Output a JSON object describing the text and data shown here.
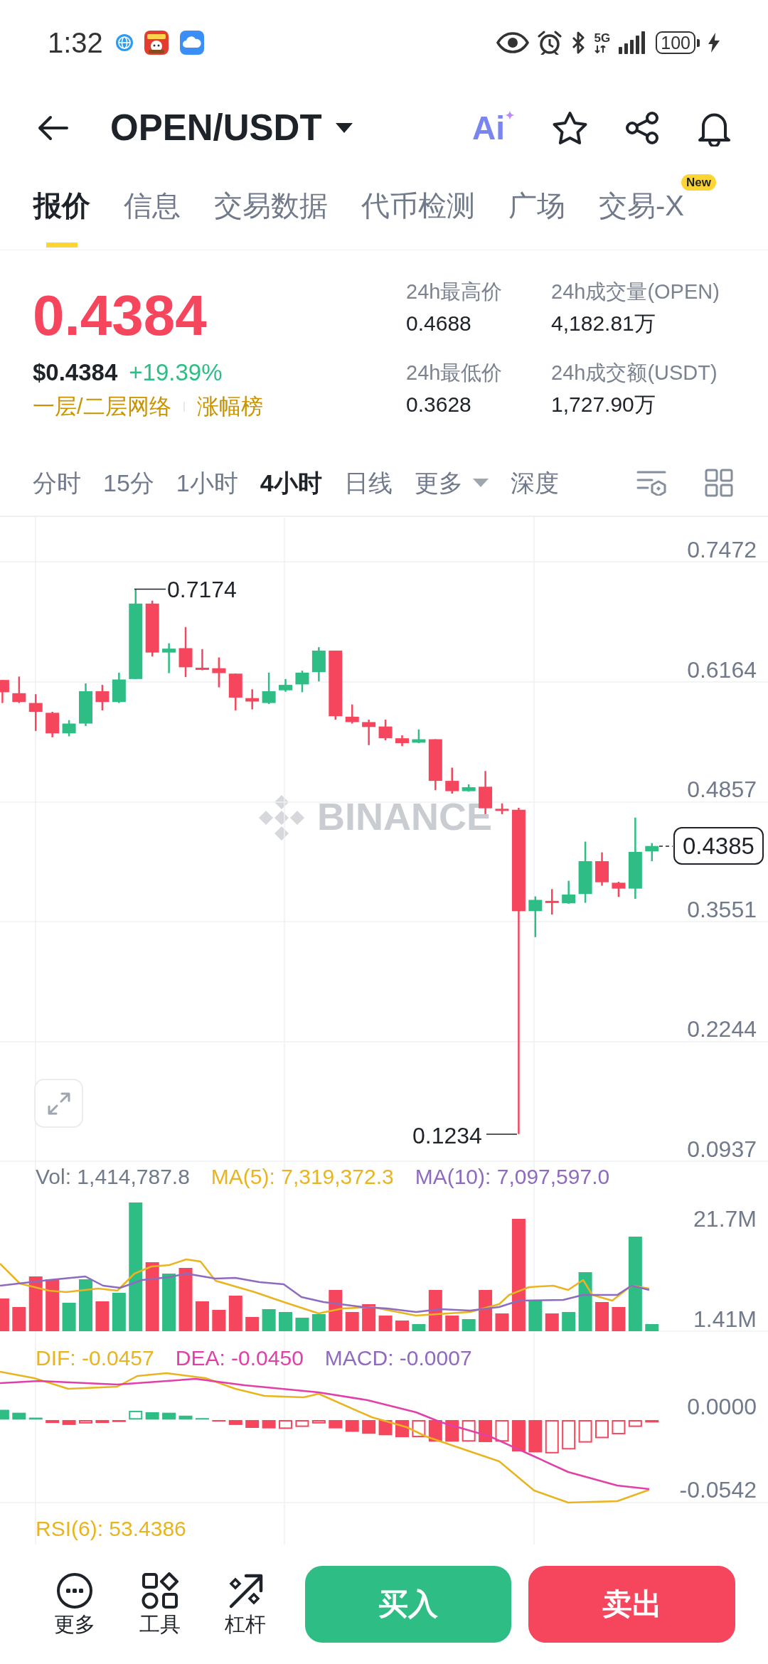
{
  "status_bar": {
    "time": "1:32",
    "network": "5G",
    "battery": "100"
  },
  "header": {
    "pair": "OPEN/USDT",
    "ai_label": "Ai"
  },
  "tabs": [
    {
      "label": "报价",
      "selected": true
    },
    {
      "label": "信息",
      "selected": false
    },
    {
      "label": "交易数据",
      "selected": false
    },
    {
      "label": "代币检测",
      "selected": false
    },
    {
      "label": "广场",
      "selected": false
    },
    {
      "label": "交易-X",
      "selected": false,
      "badge": "New"
    }
  ],
  "price": {
    "last": "0.4384",
    "usd": "$0.4384",
    "change": "+19.39%",
    "tags": [
      "一层/二层网络",
      "涨幅榜"
    ]
  },
  "stats": [
    {
      "label": "24h最高价",
      "value": "0.4688"
    },
    {
      "label": "24h成交量(OPEN)",
      "value": "4,182.81万"
    },
    {
      "label": "24h最低价",
      "value": "0.3628"
    },
    {
      "label": "24h成交额(USDT)",
      "value": "1,727.90万"
    }
  ],
  "intervals": [
    {
      "label": "分时",
      "selected": false,
      "dropdown": false
    },
    {
      "label": "15分",
      "selected": false,
      "dropdown": false
    },
    {
      "label": "1小时",
      "selected": false,
      "dropdown": false
    },
    {
      "label": "4小时",
      "selected": true,
      "dropdown": false
    },
    {
      "label": "日线",
      "selected": false,
      "dropdown": false
    },
    {
      "label": "更多",
      "selected": false,
      "dropdown": true
    },
    {
      "label": "深度",
      "selected": false,
      "dropdown": false
    }
  ],
  "price_chart": {
    "watermark": "BINANCE",
    "axis_labels": [
      "0.7472",
      "0.6164",
      "0.4857",
      "0.3551",
      "0.2244",
      "0.0937"
    ],
    "high_marker": "0.7174",
    "low_marker": "0.1234",
    "last_price": "0.4385"
  },
  "volume": {
    "legend": [
      {
        "text": "Vol: 1,414,787.8",
        "color": "#707a8a"
      },
      {
        "text": "MA(5): 7,319,372.3",
        "color": "#e8b520"
      },
      {
        "text": "MA(10): 7,097,597.0",
        "color": "#8e6bbf"
      }
    ],
    "axis_labels": [
      "21.7M",
      "1.41M"
    ]
  },
  "macd": {
    "legend": [
      {
        "text": "DIF: -0.0457",
        "color": "#e8b520"
      },
      {
        "text": "DEA: -0.0450",
        "color": "#e040a8"
      },
      {
        "text": "MACD: -0.0007",
        "color": "#8e6bbf"
      }
    ],
    "axis_labels": [
      "0.0000",
      "-0.0542"
    ]
  },
  "rsi_label": "RSI(6): 53.4386",
  "bottom_bar": {
    "tools": [
      {
        "kind": "more",
        "label": "更多"
      },
      {
        "kind": "tools",
        "label": "工具"
      },
      {
        "kind": "leverage",
        "label": "杠杆"
      }
    ],
    "buy": "买入",
    "sell": "卖出"
  }
}
